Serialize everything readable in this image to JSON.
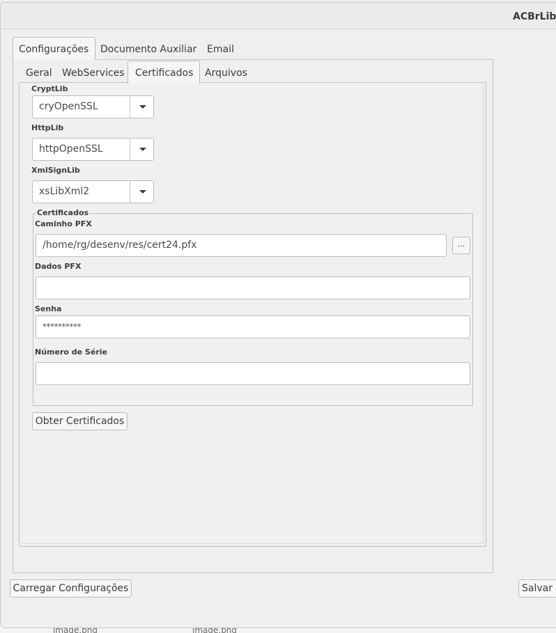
{
  "window": {
    "title": "ACBrLibN"
  },
  "background": {
    "files": [
      "image.png",
      "image.png"
    ]
  },
  "main_tabs": [
    {
      "label": "Configurações",
      "active": true
    },
    {
      "label": "Documento Auxiliar",
      "active": false
    },
    {
      "label": "Email",
      "active": false
    }
  ],
  "sub_tabs": [
    {
      "label": "Geral",
      "active": false
    },
    {
      "label": "WebServices",
      "active": false
    },
    {
      "label": "Certificados",
      "active": true
    },
    {
      "label": "Arquivos",
      "active": false
    }
  ],
  "crypt": {
    "label": "CryptLib",
    "value": "cryOpenSSL"
  },
  "http": {
    "label": "HttpLib",
    "value": "httpOpenSSL"
  },
  "xmlsign": {
    "label": "XmlSignLib",
    "value": "xsLibXml2"
  },
  "certificados": {
    "group_title": "Certificados",
    "caminho_label": "Caminho PFX",
    "caminho_value": "/home/rg/desenv/res/cert24.pfx",
    "browse_label": "...",
    "dados_label": "Dados PFX",
    "dados_value": "",
    "senha_label": "Senha",
    "senha_value": "**********",
    "serie_label": "Número de Série",
    "serie_value": ""
  },
  "obter_button": "Obter Certificados",
  "footer": {
    "load_button": "Carregar Configurações",
    "save_button": "Salvar C"
  },
  "colors": {
    "window_bg": "#efefef",
    "panel_bg": "#f0f0f0",
    "field_bg": "#ffffff",
    "border": "#bcbcbc"
  }
}
